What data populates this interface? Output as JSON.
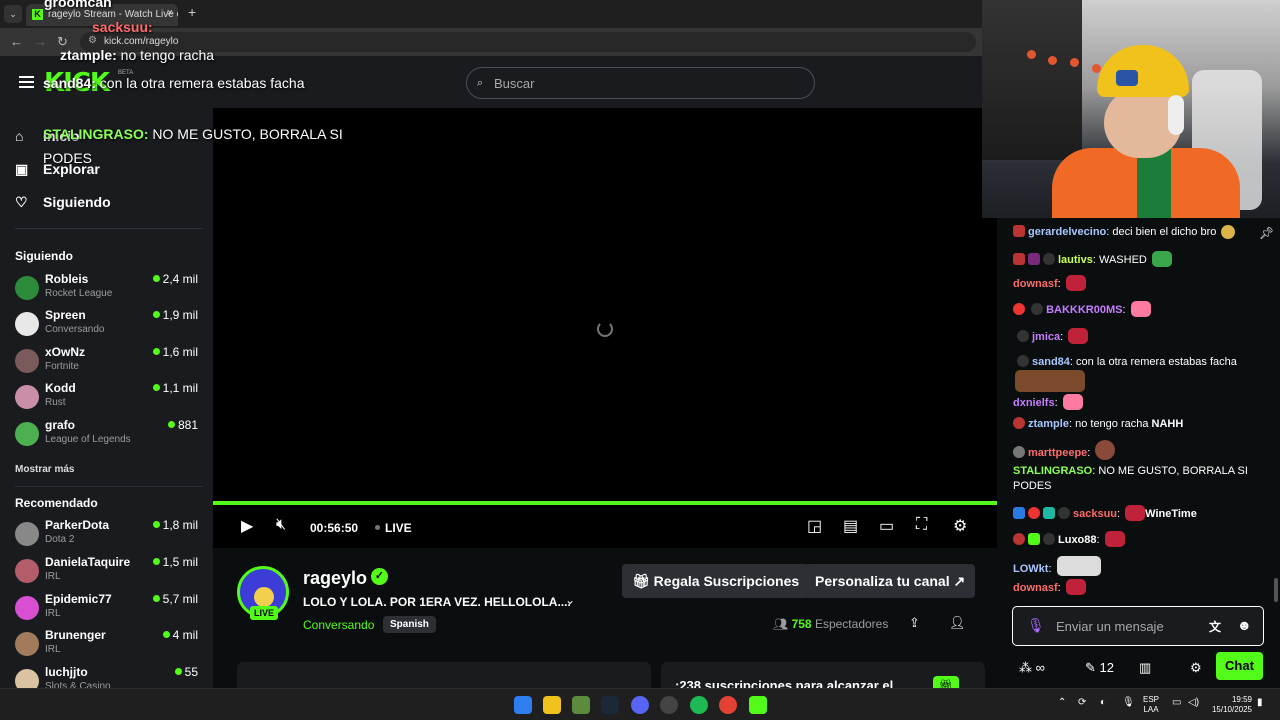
{
  "browser": {
    "tab_title": "rageylo Stream - Watch Live on Kick",
    "url": "kick.com/rageylo",
    "new_tab": "+",
    "close": "×"
  },
  "header": {
    "logo": "KICK",
    "beta": "BETA",
    "search_placeholder": "Buscar"
  },
  "sidebar": {
    "nav": [
      {
        "label": "Inicio",
        "icon": "home-icon"
      },
      {
        "label": "Explorar",
        "icon": "compass-icon"
      },
      {
        "label": "Siguiendo",
        "icon": "heart-icon"
      }
    ],
    "following_title": "Siguiendo",
    "following": [
      {
        "name": "Robleis",
        "game": "Rocket League",
        "viewers": "2,4 mil",
        "color": "#2d8c3a"
      },
      {
        "name": "Spreen",
        "game": "Conversando",
        "viewers": "1,9 mil",
        "color": "#e8e8e8"
      },
      {
        "name": "xOwNz",
        "game": "Fortnite",
        "viewers": "1,6 mil",
        "color": "#7a5a5a"
      },
      {
        "name": "Kodd",
        "game": "Rust",
        "viewers": "1,1 mil",
        "color": "#c98fa8"
      },
      {
        "name": "grafo",
        "game": "League of Legends",
        "viewers": "881",
        "color": "#4caf50"
      }
    ],
    "show_more": "Mostrar más",
    "recommended_title": "Recomendado",
    "recommended": [
      {
        "name": "ParkerDota",
        "game": "Dota 2",
        "viewers": "1,8 mil",
        "color": "#888"
      },
      {
        "name": "DanielaTaquire",
        "game": "IRL",
        "viewers": "1,5 mil",
        "color": "#b35d6b"
      },
      {
        "name": "Epidemic77",
        "game": "IRL",
        "viewers": "5,7 mil",
        "color": "#d94fd2"
      },
      {
        "name": "Brunenger",
        "game": "IRL",
        "viewers": "4 mil",
        "color": "#a27a5c"
      },
      {
        "name": "luchjjto",
        "game": "Slots & Casino",
        "viewers": "55",
        "color": "#d9c3a1"
      }
    ]
  },
  "overlay": {
    "lines": [
      {
        "user": "groomcah",
        "text": ""
      },
      {
        "user": "sacksuu:",
        "text": ""
      },
      {
        "user": "ztample:",
        "text": " no tengo racha"
      },
      {
        "user": "sand84:",
        "text": " con la otra remera estabas facha"
      },
      {
        "user": "STALINGRASO:",
        "text": " NO ME GUSTO, BORRALA SI"
      },
      {
        "user": "",
        "text": "PODES"
      }
    ]
  },
  "player": {
    "timecode": "00:56:50",
    "live": "LIVE"
  },
  "channel": {
    "name": "rageylo",
    "live_badge": "LIVE",
    "title": "LOLO Y LOLA. POR 1ERA VEZ. HELLOLOLA....",
    "category": "Conversando",
    "language": "Spanish",
    "gift_button": "Regala Suscripciones",
    "customize_button": "Personaliza tu canal",
    "viewer_count": "758",
    "viewer_label": "Espectadores",
    "sub_goal": ":238 suscripciones para alcanzar el"
  },
  "chat": {
    "messages": [
      {
        "user": "gerardelvecino",
        "color": "#a9c7ff",
        "text": "deci bien el dicho bro"
      },
      {
        "user": "lautivs",
        "color": "#c9ff5a",
        "text": "WASHED"
      },
      {
        "user": "downasf",
        "color": "#ff6b6b",
        "text": ""
      },
      {
        "user": "BAKKKR00MS",
        "color": "#c77dff",
        "text": ""
      },
      {
        "user": "jmica",
        "color": "#c77dff",
        "text": ""
      },
      {
        "user": "sand84",
        "color": "#a9c7ff",
        "text": "con la otra remera estabas facha"
      },
      {
        "user": "dxnielfs",
        "color": "#c77dff",
        "text": ""
      },
      {
        "user": "ztample",
        "color": "#a9c7ff",
        "text": "no tengo racha",
        "emote": "NAHH"
      },
      {
        "user": "marttpeepe",
        "color": "#ff6b6b",
        "text": ""
      },
      {
        "user": "STALINGRASO",
        "color": "#8dff5a",
        "text": "NO ME GUSTO, BORRALA SI",
        "text2": "PODES"
      },
      {
        "user": "sacksuu",
        "color": "#ff6b6b",
        "text": "",
        "emote": "WineTime"
      },
      {
        "user": "Luxo88",
        "color": "#ffffff",
        "text": ""
      },
      {
        "user": "LOWkt",
        "color": "#a9c7ff",
        "text": ""
      },
      {
        "user": "downasf",
        "color": "#ff6b6b",
        "text": ""
      }
    ],
    "input_placeholder": "Enviar un mensaje",
    "kicks": "12",
    "send_button": "Chat"
  },
  "taskbar": {
    "lang_top": "ESP",
    "lang_bottom": "LAA",
    "time": "19:59",
    "date": "15/10/2025"
  },
  "colors": {
    "accent": "#53fc18",
    "bg": "#0b0e0f",
    "panel": "#191b1f"
  }
}
